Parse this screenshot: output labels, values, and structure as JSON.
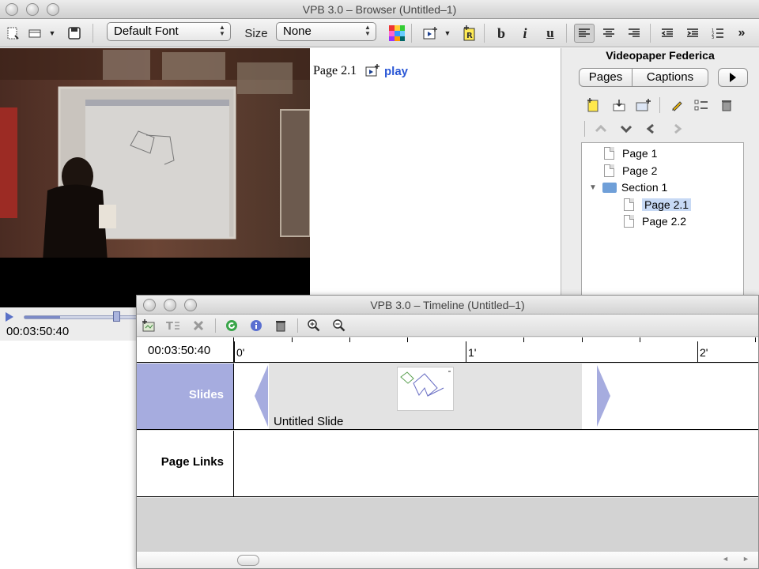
{
  "browser_window": {
    "title": "VPB 3.0 – Browser (Untitled–1)",
    "toolbar": {
      "font_select": "Default Font",
      "size_label": "Size",
      "size_select": "None",
      "bold": "b",
      "italic": "i",
      "underline": "u",
      "more": "»"
    }
  },
  "video": {
    "timecode": "00:03:50:40",
    "progress_fraction": 0.62
  },
  "editor": {
    "page_title": "Page 2.1",
    "play_link": "play"
  },
  "sidebar": {
    "title": "Videopaper Federica",
    "tabs": [
      "Pages",
      "Captions"
    ],
    "tree": [
      {
        "label": "Page 1",
        "type": "page",
        "level": 0
      },
      {
        "label": "Page 2",
        "type": "page",
        "level": 0
      },
      {
        "label": "Section 1",
        "type": "section",
        "level": 0,
        "expanded": true
      },
      {
        "label": "Page 2.1",
        "type": "page",
        "level": 1,
        "selected": true
      },
      {
        "label": "Page 2.2",
        "type": "page",
        "level": 1
      }
    ]
  },
  "timeline_window": {
    "title": "VPB 3.0 – Timeline (Untitled–1)",
    "timecode": "00:03:50:40",
    "ticks": [
      "0'",
      "1'",
      "2'"
    ],
    "rows": {
      "slides": "Slides",
      "page_links": "Page Links"
    },
    "slide_clip_label": "Untitled Slide",
    "colors": {
      "slides_row": "#a6acdf",
      "clip_arrow": "#a6acdf"
    }
  }
}
